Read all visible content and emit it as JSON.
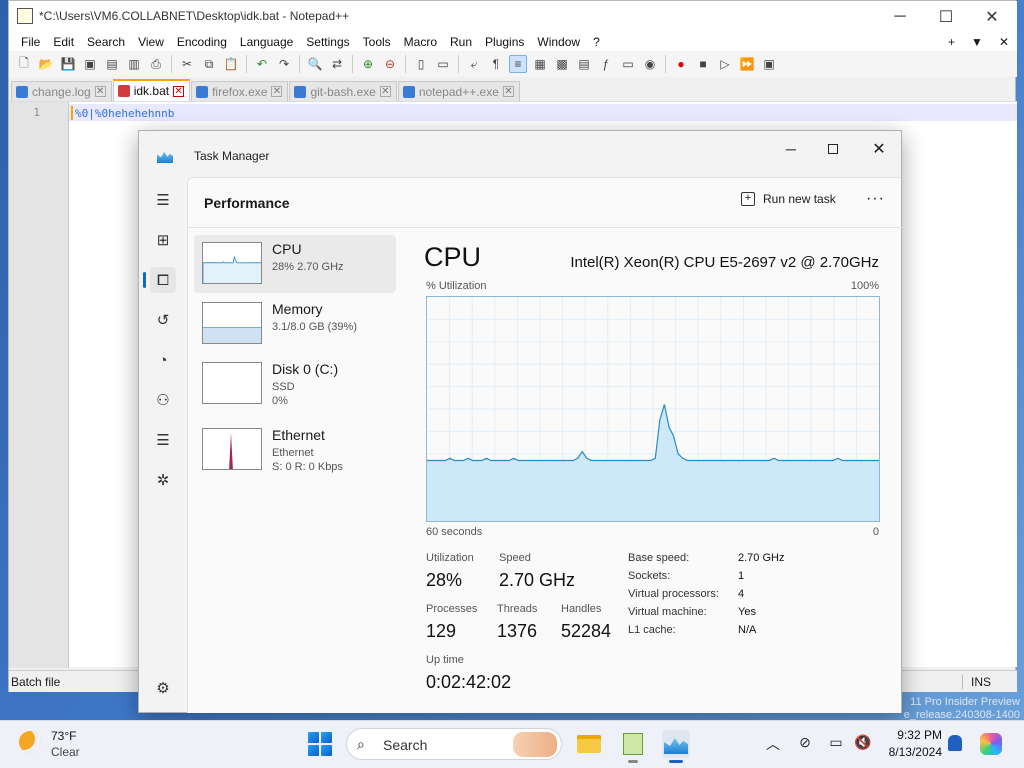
{
  "notepad": {
    "title": "*C:\\Users\\VM6.COLLABNET\\Desktop\\idk.bat - Notepad++",
    "menu": [
      "File",
      "Edit",
      "Search",
      "View",
      "Encoding",
      "Language",
      "Settings",
      "Tools",
      "Macro",
      "Run",
      "Plugins",
      "Window",
      "?"
    ],
    "menu_right": [
      "+",
      "▼",
      "✕"
    ],
    "tabs": [
      {
        "label": "change.log",
        "active": false
      },
      {
        "label": "idk.bat",
        "active": true
      },
      {
        "label": "firefox.exe",
        "active": false
      },
      {
        "label": "git-bash.exe",
        "active": false
      },
      {
        "label": "notepad++.exe",
        "active": false
      }
    ],
    "line_number": "1",
    "code_line": "%0|%0hehehehnnb",
    "status_left": "Batch file",
    "status_right": "INS"
  },
  "task_manager": {
    "title": "Task Manager",
    "section": "Performance",
    "run_new_task": "Run new task",
    "more": "···",
    "devices": [
      {
        "name": "CPU",
        "line1": "28% 2.70 GHz",
        "line2": "",
        "selected": true
      },
      {
        "name": "Memory",
        "line1": "3.1/8.0 GB (39%)",
        "line2": "",
        "selected": false
      },
      {
        "name": "Disk 0 (C:)",
        "line1": "SSD",
        "line2": "0%",
        "selected": false
      },
      {
        "name": "Ethernet",
        "line1": "Ethernet",
        "line2": "S: 0 R: 0 Kbps",
        "selected": false
      }
    ],
    "memory_fill": 0.39,
    "cpu": {
      "title": "CPU",
      "model": "Intel(R) Xeon(R) CPU E5-2697 v2 @ 2.70GHz",
      "util_label": "% Utilization",
      "util_max": "100%",
      "x_left": "60 seconds",
      "x_right": "0",
      "graph_color": "#cde9f7",
      "graph_line": "#2a8ac4",
      "stats": {
        "utilization": {
          "label": "Utilization",
          "value": "28%"
        },
        "speed": {
          "label": "Speed",
          "value": "2.70 GHz"
        },
        "processes": {
          "label": "Processes",
          "value": "129"
        },
        "threads": {
          "label": "Threads",
          "value": "1376"
        },
        "handles": {
          "label": "Handles",
          "value": "52284"
        },
        "uptime": {
          "label": "Up time",
          "value": "0:02:42:02"
        }
      },
      "specs": [
        {
          "k": "Base speed:",
          "v": "2.70 GHz"
        },
        {
          "k": "Sockets:",
          "v": "1"
        },
        {
          "k": "Virtual processors:",
          "v": "4"
        },
        {
          "k": "Virtual machine:",
          "v": "Yes"
        },
        {
          "k": "L1 cache:",
          "v": "N/A"
        }
      ],
      "history": [
        27,
        27,
        27,
        27,
        27,
        28,
        27,
        27,
        27,
        28,
        27,
        27,
        27,
        28,
        27,
        27,
        27,
        27,
        27,
        28,
        27,
        27,
        27,
        27,
        27,
        27,
        27,
        27,
        27,
        27,
        27,
        27,
        27,
        28,
        31,
        28,
        27,
        27,
        27,
        27,
        27,
        27,
        27,
        27,
        27,
        27,
        27,
        27,
        27,
        27,
        28,
        45,
        52,
        42,
        38,
        30,
        28,
        27,
        27,
        27,
        27,
        27,
        27,
        27,
        27,
        27,
        27,
        27,
        27,
        27,
        27,
        27,
        27,
        27,
        27,
        27,
        28,
        27,
        27,
        27,
        27,
        27,
        27,
        27,
        27,
        27,
        27,
        27,
        27,
        27,
        28,
        27,
        27,
        27,
        27,
        27,
        27,
        27,
        27,
        27
      ]
    }
  },
  "watermark": [
    "11 Pro Insider Preview",
    "e_release.240308-1400"
  ],
  "taskbar": {
    "weather_temp": "73°F",
    "weather_cond": "Clear",
    "search_placeholder": "Search",
    "time": "9:32 PM",
    "date": "8/13/2024"
  }
}
